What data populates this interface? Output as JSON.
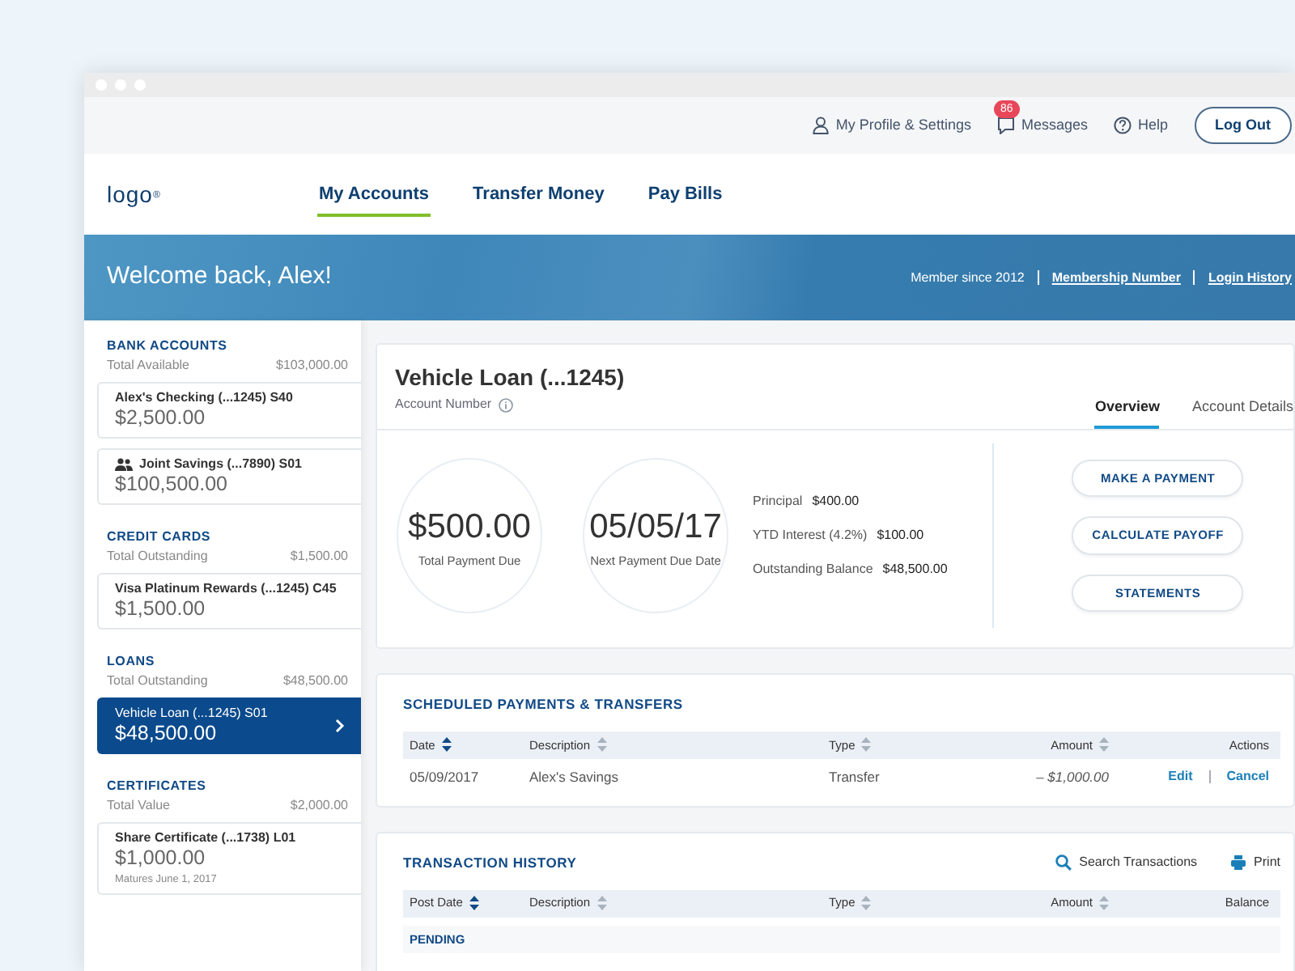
{
  "utility_links": [
    {
      "kind": "profile",
      "label": "My Profile & Settings"
    },
    {
      "kind": "messages",
      "label": "Messages",
      "badge": "86"
    },
    {
      "kind": "help",
      "label": "Help"
    }
  ],
  "logout": "Log Out",
  "logo": "logo$^{®}$",
  "nav_tabs": [
    {
      "label": "My Accounts",
      "selected": true
    },
    {
      "label": "Transfer Money",
      "selected": false
    },
    {
      "label": "Pay Bills",
      "selected": false
    }
  ],
  "banner": {
    "welcome": "Welcome back, Alex!",
    "member_since": "Member since 2012",
    "links": [
      "Membership Number",
      "Login History"
    ]
  },
  "sidebar": {
    "groups": [
      {
        "title": "BANK ACCOUNTS",
        "total_label": "Total Available",
        "total": "$103,000.00",
        "accounts": [
          {
            "name": "Alex's Checking (...1245) S40",
            "balance": "$2,500.00",
            "joint": false,
            "selected": false
          },
          {
            "name": "Joint Savings (...7890) S01",
            "balance": "$100,500.00",
            "joint": true,
            "selected": false
          }
        ]
      },
      {
        "title": "CREDIT CARDS",
        "total_label": "Total Outstanding",
        "total": "$1,500.00",
        "accounts": [
          {
            "name": "Visa Platinum Rewards (...1245) C45",
            "balance": "$1,500.00",
            "joint": false,
            "selected": false
          }
        ]
      },
      {
        "title": "LOANS",
        "total_label": "Total Outstanding",
        "total": "$48,500.00",
        "accounts": [
          {
            "name": "Vehicle Loan (...1245) S01",
            "balance": "$48,500.00",
            "joint": false,
            "selected": true
          }
        ]
      },
      {
        "title": "CERTIFICATES",
        "total_label": "Total Value",
        "total": "$2,000.00",
        "accounts": [
          {
            "name": "Share Certificate (...1738) L01",
            "balance": "$1,000.00",
            "joint": false,
            "selected": false,
            "note": "Matures June 1, 2017"
          }
        ]
      }
    ]
  },
  "account": {
    "title": "Vehicle Loan (...1245)",
    "subtitle": "Account Number",
    "tabs": [
      {
        "label": "Overview",
        "selected": true
      },
      {
        "label": "Account Details",
        "selected": false
      }
    ],
    "summary": [
      {
        "value": "$500.00",
        "label": "Total Payment Due"
      },
      {
        "value": "05/05/17",
        "label": "Next Payment Due Date"
      }
    ],
    "details": [
      {
        "label": "Principal",
        "value": "$400.00"
      },
      {
        "label": "YTD Interest (4.2%)",
        "value": "$100.00"
      },
      {
        "label": "Outstanding Balance",
        "value": "$48,500.00"
      }
    ],
    "actions": [
      "MAKE A PAYMENT",
      "CALCULATE PAYOFF",
      "STATEMENTS"
    ]
  },
  "scheduled": {
    "title": "SCHEDULED PAYMENTS & TRANSFERS",
    "columns": [
      {
        "label": "Date",
        "sortable": true,
        "sorted": true
      },
      {
        "label": "Description",
        "sortable": true,
        "sorted": false
      },
      {
        "label": "Type",
        "sortable": true,
        "sorted": false
      },
      {
        "label": "Amount",
        "sortable": true,
        "sorted": false
      },
      {
        "label": "Actions",
        "sortable": false
      }
    ],
    "rows": [
      {
        "cells": [
          "05/09/2017",
          "Alex's Savings",
          "Transfer",
          "– $1,000.00"
        ],
        "actions": [
          "Edit",
          "Cancel"
        ]
      }
    ]
  },
  "history": {
    "title": "TRANSACTION HISTORY",
    "tools": [
      {
        "kind": "search",
        "label": "Search Transactions"
      },
      {
        "kind": "print",
        "label": "Print"
      }
    ],
    "columns": [
      {
        "label": "Post Date",
        "sortable": true,
        "sorted": true
      },
      {
        "label": "Description",
        "sortable": true,
        "sorted": false
      },
      {
        "label": "Type",
        "sortable": true,
        "sorted": false
      },
      {
        "label": "Amount",
        "sortable": true,
        "sorted": false
      },
      {
        "label": "Balance",
        "sortable": false
      }
    ],
    "group_label": "PENDING"
  }
}
